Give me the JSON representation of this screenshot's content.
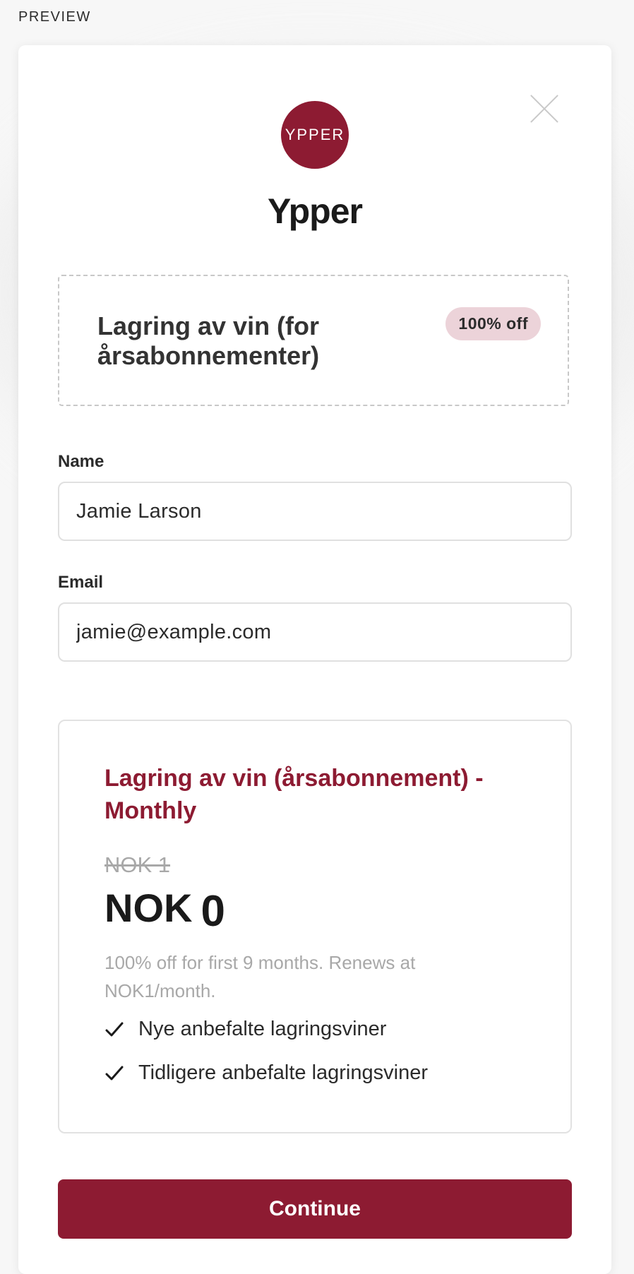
{
  "header": {
    "preview_label": "PREVIEW"
  },
  "brand": {
    "logo_text": "YPPER",
    "name": "Ypper",
    "color": "#8d1b32"
  },
  "coupon": {
    "title": "Lagring av vin (for årsabonnementer)",
    "badge": "100% off",
    "badge_color": "#ecd3d9"
  },
  "form": {
    "name_label": "Name",
    "name_value": "Jamie Larson",
    "email_label": "Email",
    "email_value": "jamie@example.com"
  },
  "plan": {
    "title": "Lagring av vin (årsabonnement) - Monthly",
    "old_price": "NOK 1",
    "currency": "NOK",
    "amount": "0",
    "note": "100% off for first 9 months. Renews at NOK1/month.",
    "features": [
      "Nye anbefalte lagringsviner",
      "Tidligere anbefalte lagringsviner"
    ]
  },
  "actions": {
    "continue_label": "Continue"
  },
  "icons": {
    "close": "close-icon",
    "check": "check-icon"
  }
}
